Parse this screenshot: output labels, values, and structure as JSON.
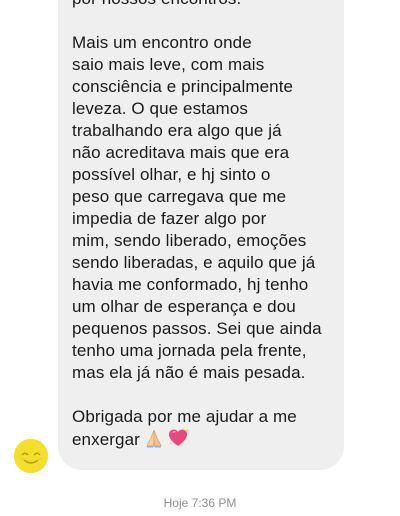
{
  "message": {
    "lines": [
      "por nossos encontros.",
      "",
      "Mais um encontro onde",
      "saio mais leve, com mais",
      "consciência e principalmente",
      "leveza. O que estamos",
      "trabalhando era algo que já",
      "não acreditava mais que era",
      "possível olhar, e hj sinto o",
      "peso que carregava que me",
      "impedia de fazer algo por",
      "mim, sendo liberado, emoções",
      "sendo liberadas, e aquilo que já",
      "havia me conformado, hj tenho",
      "um olhar de esperança e dou",
      "pequenos passos. Sei que ainda",
      "tenho uma jornada pela frente,",
      "mas ela já não é mais pesada.",
      "",
      "Obrigada por me ajudar a me",
      "enxergar"
    ],
    "emojis": [
      "folded-hands-icon",
      "sparkling-heart-icon"
    ]
  },
  "sender": {
    "avatar_icon": "smiling-face-avatar-icon",
    "avatar_color": "#f4df2c"
  },
  "timestamp": "Hoje 7:36 PM",
  "colors": {
    "bubble": "#efefef",
    "text": "#1a1a1a",
    "timestamp": "#8e8e8e"
  }
}
